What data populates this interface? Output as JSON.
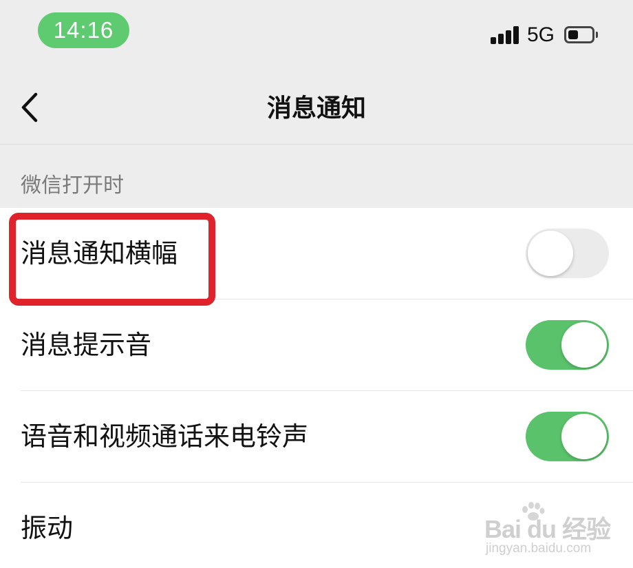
{
  "status_bar": {
    "time": "14:16",
    "network": "5G",
    "battery_level": 0.45,
    "signal_bars": 4,
    "time_pill_color": "#5fcb70"
  },
  "nav": {
    "title": "消息通知",
    "back_icon": "chevron-left-icon"
  },
  "section": {
    "header": "微信打开时"
  },
  "settings": [
    {
      "label": "消息通知横幅",
      "toggle": "off"
    },
    {
      "label": "消息提示音",
      "toggle": "on"
    },
    {
      "label": "语音和视频通话来电铃声",
      "toggle": "on"
    },
    {
      "label": "振动"
    }
  ],
  "colors": {
    "toggle_on": "#5ac26a",
    "toggle_off": "#ebebeb",
    "highlight": "#e0222b",
    "background": "#ededed"
  },
  "watermark": {
    "brand": "Bai du 经验",
    "domain": "jingyan.baidu.com"
  }
}
